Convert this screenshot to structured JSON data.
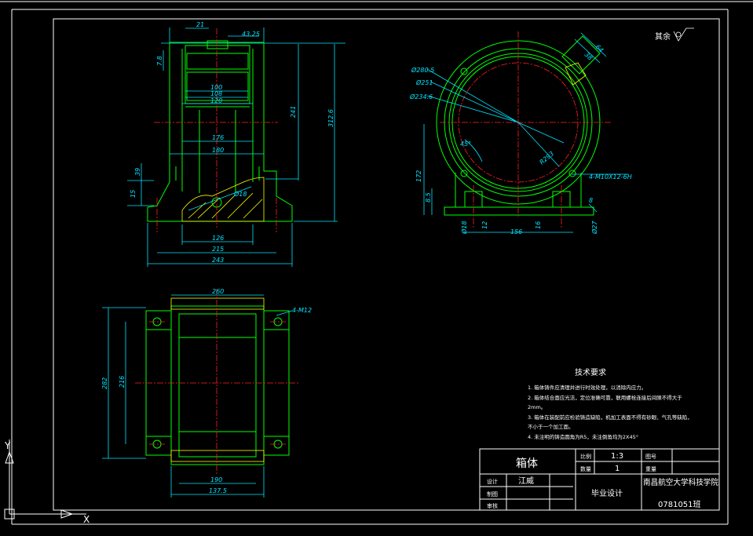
{
  "roughness_symbol": {
    "label": "其余"
  },
  "front_view": {
    "dims": [
      "21",
      "43.25",
      "7.8",
      "100",
      "108",
      "120",
      "241",
      "312.6",
      "176",
      "180",
      "39",
      "15",
      "Ø18",
      "126",
      "215",
      "243"
    ]
  },
  "side_view": {
    "dims": [
      "Ø280.5",
      "Ø251",
      "Ø234.6",
      "64",
      "38",
      "45°",
      "R293",
      "4-M10X12-6H",
      "172",
      "8.5",
      "Ø18",
      "12",
      "156",
      "16",
      "8",
      "Ø27"
    ]
  },
  "top_view": {
    "dims": [
      "260",
      "4-M12",
      "282",
      "216",
      "190",
      "137.5"
    ]
  },
  "technical_requirements": {
    "title": "技术要求",
    "items": [
      "1. 箱体铸件应清理并进行时效处理，以消除内应力。",
      "2. 箱体结合面应光洁，定位准确可靠，联用螺栓连接后间隙不得大于",
      "   2mm。",
      "3. 箱体在装配前应检验铸造缺陷，机加工表面不得有砂眼、气孔等缺陷，",
      "   不小于一个加工面。",
      "4. 未注明的铸造圆角为R5，未注倒角均为2X45°"
    ]
  },
  "title_block": {
    "part_name": "箱体",
    "scale_label": "比例",
    "scale_value": "1:3",
    "drawing_no_label": "图号",
    "quantity_label": "数量",
    "quantity_value": "1",
    "weight_label": "重量",
    "designer_label": "设计",
    "designer_name": "江威",
    "drafter_label": "制图",
    "reviewer_label": "审核",
    "project": "毕业设计",
    "school": "南昌航空大学科技学院",
    "class_no": "0781051班"
  },
  "ucs": {
    "x_label": "X",
    "y_label": "Y"
  }
}
